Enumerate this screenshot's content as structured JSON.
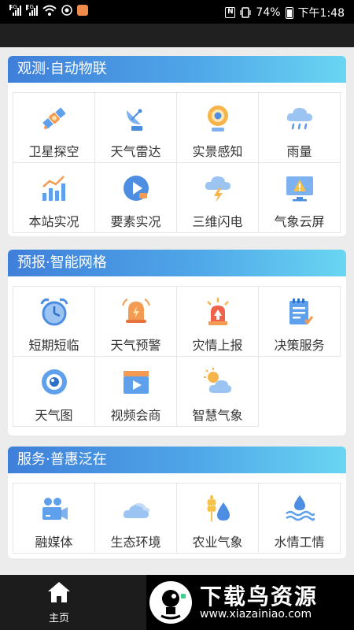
{
  "status_bar": {
    "signal_1_label": "4G",
    "signal_2_label": "2G",
    "battery_percent": "74%",
    "time": "下午1:48"
  },
  "sections": [
    {
      "title": "观测·自动物联",
      "items": [
        {
          "label": "卫星探空",
          "icon": "satellite-icon"
        },
        {
          "label": "天气雷达",
          "icon": "radar-dish-icon"
        },
        {
          "label": "实景感知",
          "icon": "webcam-icon"
        },
        {
          "label": "雨量",
          "icon": "rain-cloud-icon"
        },
        {
          "label": "本站实况",
          "icon": "bar-chart-icon"
        },
        {
          "label": "要素实况",
          "icon": "video-play-icon"
        },
        {
          "label": "三维闪电",
          "icon": "lightning-cloud-icon"
        },
        {
          "label": "气象云屏",
          "icon": "warning-monitor-icon"
        }
      ]
    },
    {
      "title": "预报·智能网格",
      "items": [
        {
          "label": "短期短临",
          "icon": "alarm-clock-icon"
        },
        {
          "label": "天气预警",
          "icon": "warning-bell-icon"
        },
        {
          "label": "灾情上报",
          "icon": "siren-icon"
        },
        {
          "label": "决策服务",
          "icon": "notepad-icon"
        },
        {
          "label": "天气图",
          "icon": "eye-icon"
        },
        {
          "label": "视频会商",
          "icon": "video-clapper-icon"
        },
        {
          "label": "智慧气象",
          "icon": "sun-cloud-icon"
        }
      ]
    },
    {
      "title": "服务·普惠泛在",
      "items": [
        {
          "label": "融媒体",
          "icon": "video-camera-icon"
        },
        {
          "label": "生态环境",
          "icon": "cloud-icon"
        },
        {
          "label": "农业气象",
          "icon": "wheat-drop-icon"
        },
        {
          "label": "水情工情",
          "icon": "water-waves-icon"
        }
      ]
    }
  ],
  "bottom_nav": {
    "home_label": "主页",
    "home_icon": "home-icon"
  },
  "watermark": {
    "name": "下载鸟资源",
    "url": "www.xiazainiao.com"
  }
}
